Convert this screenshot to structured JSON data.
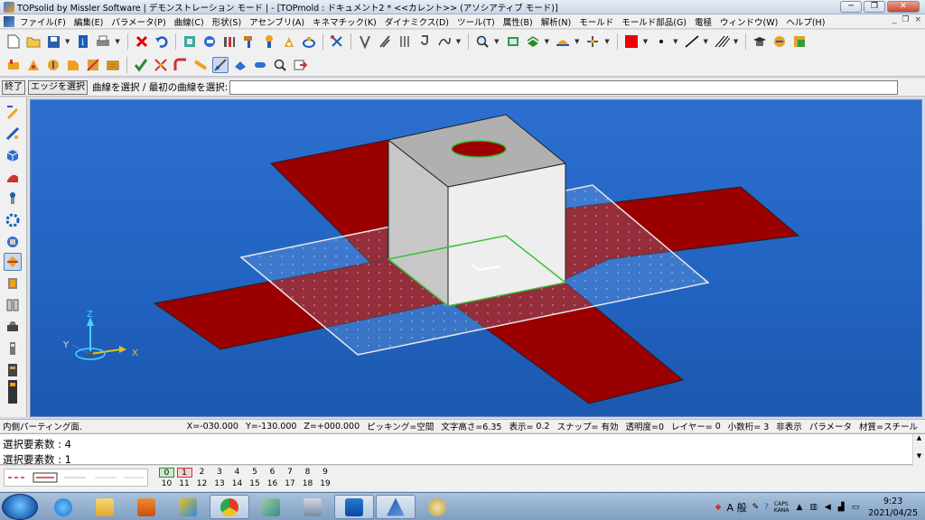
{
  "window": {
    "title": "TOPsolid by Missler Software | デモンストレーション モード | - [TOPmold : ドキュメント2 *  <<カレント>> (アソシアティブ モード)]",
    "min_glyph": "─",
    "max_glyph": "❐",
    "close_glyph": "✕"
  },
  "menu": {
    "items": [
      "ファイル(F)",
      "編集(E)",
      "パラメータ(P)",
      "曲線(C)",
      "形状(S)",
      "アセンブリ(A)",
      "キネマチック(K)",
      "ダイナミクス(D)",
      "ツール(T)",
      "属性(B)",
      "解析(N)",
      "モールド",
      "モールド部品(G)",
      "電極",
      "ウィンドウ(W)",
      "ヘルプ(H)"
    ],
    "mdi_min": "_",
    "mdi_restore": "❐",
    "mdi_close": "×"
  },
  "toolbar1": {
    "icons": [
      "new-document-icon",
      "open-folder-icon",
      "save-icon",
      "info-icon",
      "print-icon",
      "cancel-red-x-icon",
      "undo-icon",
      "element-icon",
      "fit-icon",
      "tools-icon",
      "hammer-icon",
      "tools2-icon",
      "weight-icon",
      "measure-icon",
      "selection-icon",
      "tweezers-icon",
      "spring-icon",
      "hook-icon",
      "curve-icon",
      "zoom-icon",
      "view-icon",
      "layer-icon",
      "hat-icon",
      "cross-icon",
      "color-icon",
      "point-icon",
      "line-style-icon",
      "hatch-icon",
      "mortarboard-icon",
      "render-icon",
      "shade-icon"
    ],
    "color_accent": "#ee0000"
  },
  "toolbar2": {
    "icons": [
      "mold-tool-1-icon",
      "mold-tool-2-icon",
      "mold-tool-3-icon",
      "mold-tool-4-icon",
      "mold-tool-5-icon",
      "mold-tool-6-icon",
      "check-icon",
      "cross-tools-icon",
      "bend-icon",
      "pipe-icon",
      "curve-select-icon",
      "plate-icon",
      "cylinder-icon",
      "magnify-icon",
      "insert-icon"
    ]
  },
  "command": {
    "end_label": "終了",
    "edge_select_label": "エッジを選択",
    "prompt": "曲線を選択 / 最初の曲線を選択:",
    "input_value": ""
  },
  "statusbar": {
    "mode": "内側パーティング面.",
    "x": "X=-030.000",
    "y": "Y=-130.000",
    "z": "Z=+000.000",
    "picking": "ピッキング=空間",
    "text_height": "文字高さ=6.35",
    "display_label": "表示=",
    "display_value": "0.2",
    "snap": "スナップ= 有効",
    "transparency": "透明度=0",
    "layer": "レイヤー=",
    "layer_value": "0",
    "decimals": "小数桁= 3",
    "hidden": "非表示",
    "params": "パラメータ",
    "material": "材質=スチール"
  },
  "output": {
    "line1": "選択要素数 : 4",
    "line2": "選択要素数 : 1"
  },
  "layers": {
    "top": [
      "0",
      "1",
      "2",
      "3",
      "4",
      "5",
      "6",
      "7",
      "8",
      "9"
    ],
    "bottom": [
      "10",
      "11",
      "12",
      "13",
      "14",
      "15",
      "16",
      "17",
      "18",
      "19"
    ]
  },
  "viewport": {
    "axis_x": "X",
    "axis_y": "Y",
    "axis_z": "Z",
    "colors": {
      "background": "#2163c0",
      "parting_surface": "#9a0000",
      "cube_front": "#c7c7c7",
      "cube_side": "#eeeeee",
      "cube_top": "#b0b0b0"
    }
  },
  "taskbar": {
    "apps": [
      "ie-icon",
      "explorer-icon",
      "media-icon",
      "app-icon",
      "chrome-icon",
      "notes-icon",
      "calculator-icon",
      "outlook-icon",
      "topsolid-icon",
      "paint-icon"
    ],
    "ime": "A 般",
    "caps": "CAPS",
    "kana": "KANA",
    "time": "9:23",
    "date": "2021/04/25"
  }
}
